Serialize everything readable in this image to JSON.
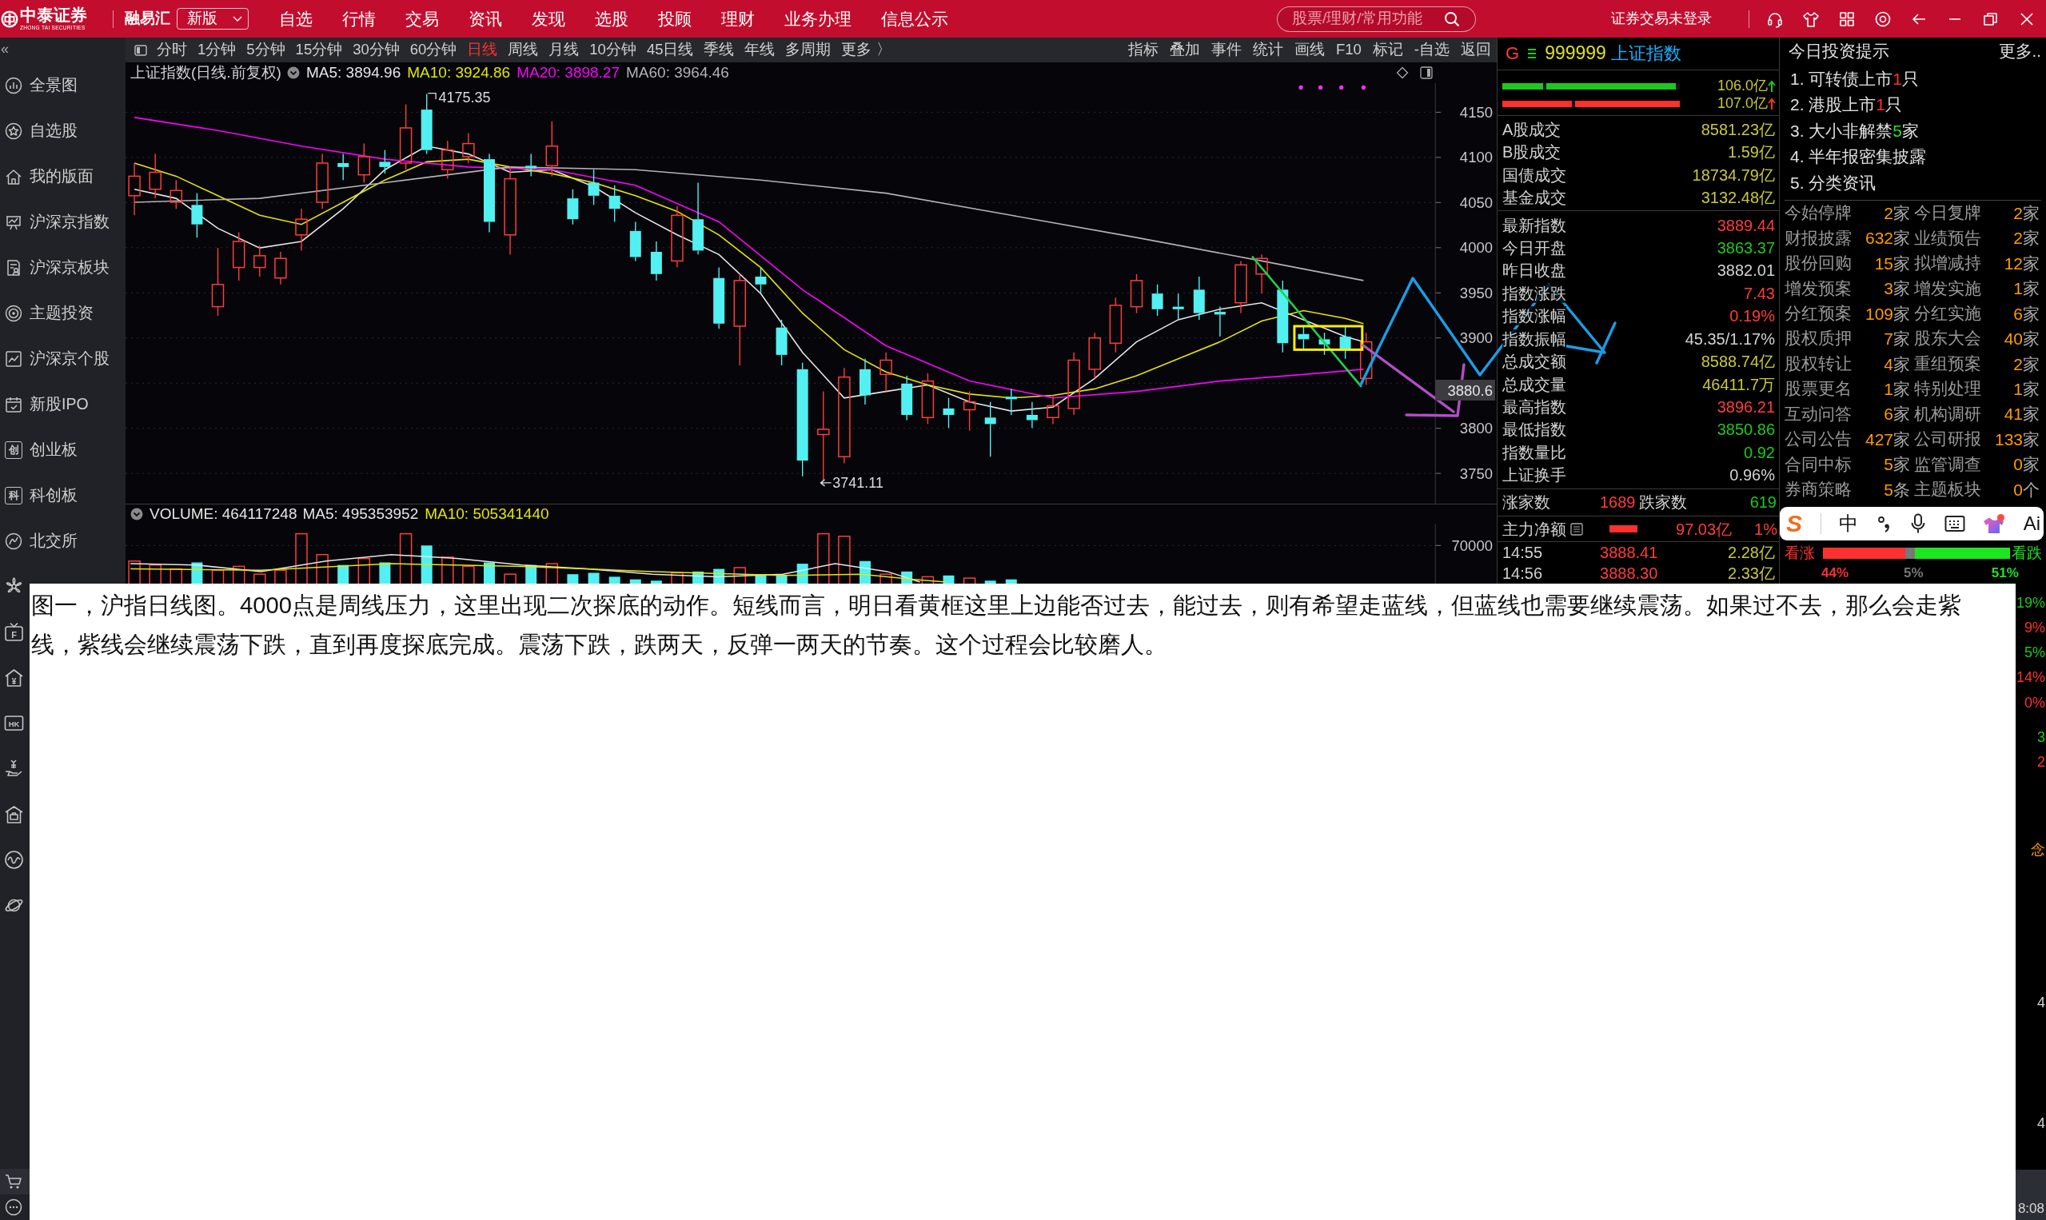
{
  "top_bar": {
    "logo": {
      "name": "中泰证券",
      "subtitle": "ZHONG TAI SECURITIES"
    },
    "product": "融易汇",
    "version": {
      "value": "新版"
    },
    "menu": [
      {
        "label": "自选"
      },
      {
        "label": "行情"
      },
      {
        "label": "交易"
      },
      {
        "label": "资讯"
      },
      {
        "label": "发现"
      },
      {
        "label": "选股"
      },
      {
        "label": "投顾"
      },
      {
        "label": "理财"
      },
      {
        "label": "业务办理"
      },
      {
        "label": "信息公示"
      }
    ],
    "search": {
      "placeholder": "股票/理财/常用功能"
    },
    "login_status": "证券交易未登录"
  },
  "sidebar": {
    "collapse": "«",
    "items": [
      {
        "label": "全景图"
      },
      {
        "label": "自选股"
      },
      {
        "label": "我的版面"
      },
      {
        "label": "沪深京指数"
      },
      {
        "label": "沪深京板块"
      },
      {
        "label": "主题投资"
      },
      {
        "label": "沪深京个股"
      },
      {
        "label": "新股IPO"
      },
      {
        "label": "创业板",
        "glyph": "创"
      },
      {
        "label": "科创板",
        "glyph": "科"
      },
      {
        "label": "北交所"
      }
    ],
    "lower_glyphs": [
      "F",
      "¥",
      "HK"
    ]
  },
  "chart": {
    "toolbar": {
      "periods": [
        {
          "label": "分时",
          "selected": false
        },
        {
          "label": "1分钟",
          "selected": false
        },
        {
          "label": "5分钟",
          "selected": false
        },
        {
          "label": "15分钟",
          "selected": false
        },
        {
          "label": "30分钟",
          "selected": false
        },
        {
          "label": "60分钟",
          "selected": false
        },
        {
          "label": "日线",
          "selected": true
        },
        {
          "label": "周线",
          "selected": false
        },
        {
          "label": "月线",
          "selected": false
        },
        {
          "label": "10分钟",
          "selected": false
        },
        {
          "label": "45日线",
          "selected": false
        },
        {
          "label": "季线",
          "selected": false
        },
        {
          "label": "年线",
          "selected": false
        },
        {
          "label": "多周期",
          "selected": false
        },
        {
          "label": "更多 〉",
          "selected": false
        }
      ],
      "tools": [
        "指标",
        "叠加",
        "事件",
        "统计",
        "画线",
        "F10",
        "标记",
        "-自选",
        "返回"
      ]
    },
    "title": "上证指数(日线.前复权)",
    "indicators": [
      {
        "label": "MA5: 3894.96",
        "color": "#e6e6e6"
      },
      {
        "label": "MA10: 3924.86",
        "color": "#e6e600"
      },
      {
        "label": "MA20: 3898.27",
        "color": "#ff00ff"
      },
      {
        "label": "MA60: 3964.46",
        "color": "#b4b4b4"
      }
    ],
    "price_axis": [
      "4150",
      "4100",
      "4050",
      "4000",
      "3950",
      "3900",
      "3800",
      "3750"
    ],
    "high_label": "4175.35",
    "low_label": "3741.11",
    "current_price": "3880.6"
  },
  "volume": {
    "title": "VOLUME: 464117248",
    "indicators": [
      {
        "label": "MA5: 495353952",
        "color": "#e6e6e6"
      },
      {
        "label": "MA10: 505341440",
        "color": "#e6e600"
      }
    ],
    "axis": [
      "70000"
    ]
  },
  "info_panel": {
    "badge": "G",
    "code": "999999",
    "name": "上证指数",
    "flows": [
      {
        "segments": [
          {
            "level": 0.23
          },
          {
            "level": 0.73
          }
        ],
        "value": "106.0亿",
        "color": "#1ec81e"
      },
      {
        "segments": [
          {
            "level": 0.39
          },
          {
            "level": 0.59
          }
        ],
        "value": "107.0亿",
        "color": "#ff3030"
      }
    ],
    "turnover": [
      {
        "label": "A股成交",
        "value": "8581.23亿"
      },
      {
        "label": "B股成交",
        "value": "1.59亿"
      },
      {
        "label": "国债成交",
        "value": "18734.79亿"
      },
      {
        "label": "基金成交",
        "value": "3132.48亿"
      }
    ],
    "quote": [
      {
        "label": "最新指数",
        "value": "3889.44",
        "color": "#ff3c3c"
      },
      {
        "label": "今日开盘",
        "value": "3863.37",
        "color": "#1ec81e"
      },
      {
        "label": "昨日收盘",
        "value": "3882.01",
        "color": "#d2d2d2"
      },
      {
        "label": "指数涨跌",
        "value": "7.43",
        "color": "#ff3c3c"
      },
      {
        "label": "指数涨幅",
        "value": "0.19%",
        "color": "#ff3c3c"
      },
      {
        "label": "指数振幅",
        "value": "45.35/1.17%",
        "color": "#d2d2d2"
      },
      {
        "label": "总成交额",
        "value": "8588.74亿",
        "color": "#c8c83c"
      },
      {
        "label": "总成交量",
        "value": "46411.7万",
        "color": "#c8c83c"
      },
      {
        "label": "最高指数",
        "value": "3896.21",
        "color": "#ff3c3c"
      },
      {
        "label": "最低指数",
        "value": "3850.86",
        "color": "#1ec81e"
      },
      {
        "label": "指数量比",
        "value": "0.92",
        "color": "#1ec81e"
      },
      {
        "label": "上证换手",
        "value": "0.96%",
        "color": "#d2d2d2"
      }
    ],
    "breadth": {
      "up_label": "涨家数",
      "up_count": "1689",
      "down_label": "跌家数",
      "down_count": "619"
    },
    "net_flow": {
      "label": "主力净额",
      "value": "97.03亿",
      "percent": "1%"
    },
    "ticks": [
      {
        "time": "14:55",
        "price": "3888.41",
        "amount": "2.28亿"
      },
      {
        "time": "14:56",
        "price": "3888.30",
        "amount": "2.33亿"
      }
    ]
  },
  "tips_panel": {
    "title": "今日投资提示",
    "more": "更多..",
    "tips": [
      {
        "text": "1. 可转债上市",
        "count": "1",
        "unit": "只",
        "color": "#ff3030"
      },
      {
        "text": "2. 港股上市",
        "count": "1",
        "unit": "只",
        "color": "#ff3030"
      },
      {
        "text": "3. 大小非解禁",
        "count": "5",
        "unit": "家",
        "color": "#1ee61e"
      },
      {
        "text": "4. 半年报密集披露"
      },
      {
        "text": "5. 分类资讯"
      }
    ],
    "events": [
      {
        "label": "今始停牌",
        "count": "2",
        "unit": "家"
      },
      {
        "label": "今日复牌",
        "count": "2",
        "unit": "家"
      },
      {
        "label": "财报披露",
        "count": "632",
        "unit": "家"
      },
      {
        "label": "业绩预告",
        "count": "2",
        "unit": "家"
      },
      {
        "label": "股份回购",
        "count": "15",
        "unit": "家"
      },
      {
        "label": "拟增减持",
        "count": "12",
        "unit": "家"
      },
      {
        "label": "增发预案",
        "count": "3",
        "unit": "家"
      },
      {
        "label": "增发实施",
        "count": "1",
        "unit": "家"
      },
      {
        "label": "分红预案",
        "count": "109",
        "unit": "家"
      },
      {
        "label": "分红实施",
        "count": "6",
        "unit": "家"
      },
      {
        "label": "股权质押",
        "count": "7",
        "unit": "家"
      },
      {
        "label": "股东大会",
        "count": "40",
        "unit": "家"
      },
      {
        "label": "股权转让",
        "count": "4",
        "unit": "家"
      },
      {
        "label": "重组预案",
        "count": "2",
        "unit": "家"
      },
      {
        "label": "股票更名",
        "count": "1",
        "unit": "家"
      },
      {
        "label": "特别处理",
        "count": "1",
        "unit": "家"
      },
      {
        "label": "互动问答",
        "count": "6",
        "unit": "家"
      },
      {
        "label": "机构调研",
        "count": "41",
        "unit": "家"
      },
      {
        "label": "公司公告",
        "count": "427",
        "unit": "家"
      },
      {
        "label": "公司研报",
        "count": "133",
        "unit": "家"
      },
      {
        "label": "合同中标",
        "count": "5",
        "unit": "家"
      },
      {
        "label": "监管调查",
        "count": "0",
        "unit": "家"
      },
      {
        "label": "券商策略",
        "count": "5",
        "unit": "条"
      },
      {
        "label": "主题板块",
        "count": "0",
        "unit": "个"
      }
    ],
    "sentiment": {
      "bull_label": "看涨",
      "bear_label": "看跌",
      "segments": [
        {
          "level": 0.44,
          "label": "44%",
          "color": "#ff3030"
        },
        {
          "label": "5%",
          "color": "#777777"
        },
        {
          "level": 0.51,
          "label": "51%",
          "color": "#1ee61e"
        }
      ]
    }
  },
  "ime_bar": {
    "logo": "S",
    "mode": "中",
    "ai": "Ai"
  },
  "caption": "图一，沪指日线图。4000点是周线压力，这里出现二次探底的动作。短线而言，明日看黄框这里上边能否过去，能过去，则有希望走蓝线，但蓝线也需要继续震荡。如果过不去，那么会走紫线，紫线会继续震荡下跌，直到再度探底完成。震荡下跌，跌两天，反弹一两天的节奏。这个过程会比较磨人。",
  "right_edge": {
    "fragments": [
      {
        "text": "19%",
        "color": "#1ec81e"
      },
      {
        "text": "9%",
        "color": "#ff3030"
      },
      {
        "text": "5%",
        "color": "#1ec81e"
      },
      {
        "text": "14%",
        "color": "#ff3030"
      },
      {
        "text": "0%",
        "color": "#ff3030"
      },
      {
        "text": "3",
        "color": "#1ec81e"
      },
      {
        "text": "2",
        "color": "#ff3030"
      },
      {
        "text": "念",
        "color": "#ff9c00"
      },
      {
        "text": "4",
        "color": "#d2d2d2"
      },
      {
        "text": "4",
        "color": "#d2d2d2"
      }
    ],
    "clock": "8:08"
  }
}
